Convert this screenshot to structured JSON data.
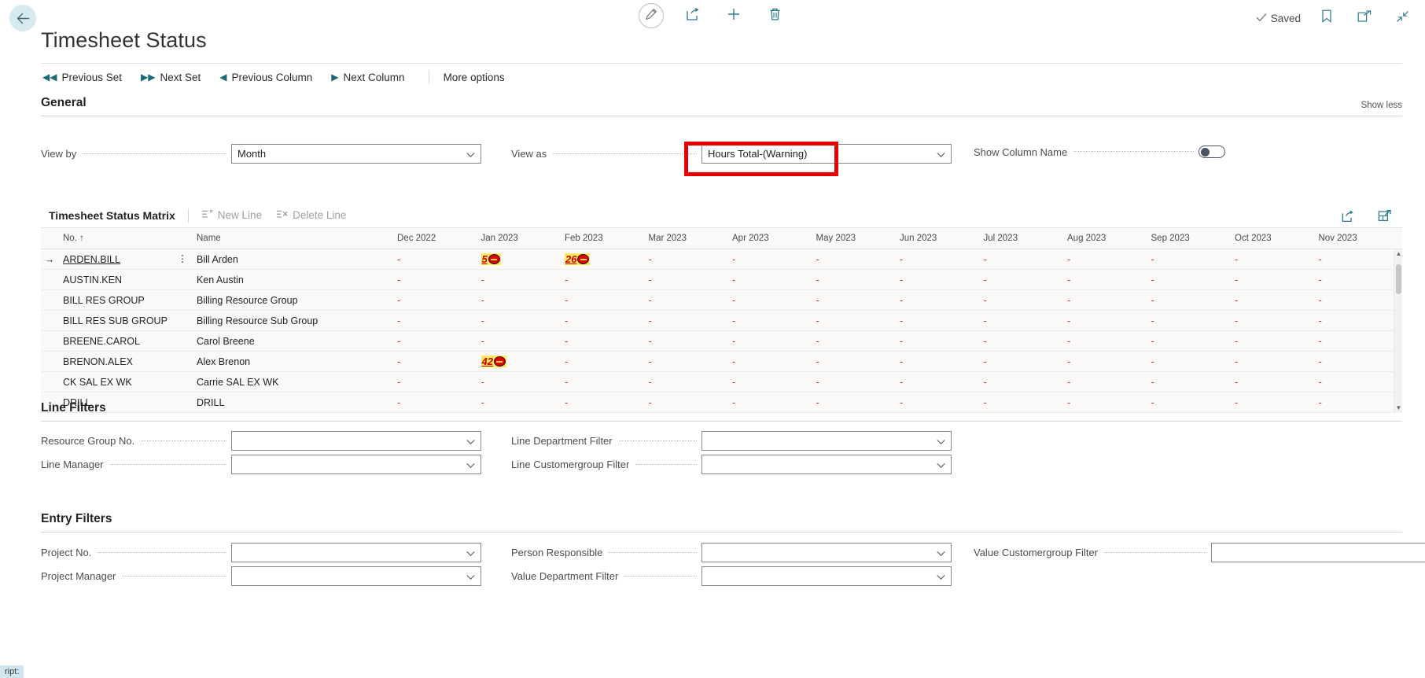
{
  "topbar": {
    "back_icon": "arrow-left-icon",
    "edit_icon": "pencil-icon",
    "share_icon": "share-icon",
    "new_icon": "plus-icon",
    "delete_icon": "trash-icon",
    "saved_label": "Saved",
    "check_icon": "check-icon",
    "bookmark_icon": "bookmark-icon",
    "open-new-window_icon": "open-in-new-window-icon",
    "collapse_icon": "collapse-icon"
  },
  "page_title": "Timesheet Status",
  "ribbon": {
    "items": [
      {
        "label": "Previous Set",
        "glyph": "◀◀",
        "icon": "previous-set-icon"
      },
      {
        "label": "Next Set",
        "glyph": "▶▶",
        "icon": "next-set-icon"
      },
      {
        "label": "Previous Column",
        "glyph": "◀",
        "icon": "previous-column-icon"
      },
      {
        "label": "Next Column",
        "glyph": "▶",
        "icon": "next-column-icon"
      }
    ],
    "more_options": "More options"
  },
  "general": {
    "title": "General",
    "show_less": "Show less",
    "view_by": {
      "label": "View by",
      "value": "Month"
    },
    "view_as": {
      "label": "View as",
      "value": "Hours Total-(Warning)"
    },
    "show_column_name": {
      "label": "Show Column Name",
      "value": "off"
    }
  },
  "highlight": {
    "color": "#e60000"
  },
  "matrix": {
    "title": "Timesheet Status Matrix",
    "new_line": "New Line",
    "delete_line": "Delete Line",
    "share_icon": "share-icon",
    "expand_icon": "open-in-excel-icon",
    "columns": [
      "No. ↑",
      "Name",
      "Dec 2022",
      "Jan 2023",
      "Feb 2023",
      "Mar 2023",
      "Apr 2023",
      "May 2023",
      "Jun 2023",
      "Jul 2023",
      "Aug 2023",
      "Sep 2023",
      "Oct 2023",
      "Nov 2023"
    ],
    "rows": [
      {
        "no": "ARDEN.BILL",
        "name": "Bill Arden",
        "selected": true,
        "values": [
          "-",
          {
            "text": "5",
            "warning": true
          },
          {
            "text": "26",
            "warning": true
          },
          "-",
          "-",
          "-",
          "-",
          "-",
          "-",
          "-",
          "-",
          "-"
        ]
      },
      {
        "no": "AUSTIN.KEN",
        "name": "Ken Austin",
        "selected": false,
        "values": [
          "-",
          "-",
          "-",
          "-",
          "-",
          "-",
          "-",
          "-",
          "-",
          "-",
          "-",
          "-"
        ]
      },
      {
        "no": "BILL RES GROUP",
        "name": "Billing Resource Group",
        "selected": false,
        "values": [
          "-",
          "-",
          "-",
          "-",
          "-",
          "-",
          "-",
          "-",
          "-",
          "-",
          "-",
          "-"
        ]
      },
      {
        "no": "BILL RES SUB GROUP",
        "name": "Billing Resource Sub Group",
        "selected": false,
        "values": [
          "-",
          "-",
          "-",
          "-",
          "-",
          "-",
          "-",
          "-",
          "-",
          "-",
          "-",
          "-"
        ]
      },
      {
        "no": "BREENE.CAROL",
        "name": "Carol Breene",
        "selected": false,
        "values": [
          "-",
          "-",
          "-",
          "-",
          "-",
          "-",
          "-",
          "-",
          "-",
          "-",
          "-",
          "-"
        ]
      },
      {
        "no": "BRENON.ALEX",
        "name": "Alex Brenon",
        "selected": false,
        "values": [
          "-",
          {
            "text": "42",
            "warning": true
          },
          "-",
          "-",
          "-",
          "-",
          "-",
          "-",
          "-",
          "-",
          "-",
          "-"
        ]
      },
      {
        "no": "CK SAL EX WK",
        "name": "Carrie SAL EX WK",
        "selected": false,
        "values": [
          "-",
          "-",
          "-",
          "-",
          "-",
          "-",
          "-",
          "-",
          "-",
          "-",
          "-",
          "-"
        ]
      },
      {
        "no": "DRILL",
        "name": "DRILL",
        "selected": false,
        "values": [
          "-",
          "-",
          "-",
          "-",
          "-",
          "-",
          "-",
          "-",
          "-",
          "-",
          "-",
          "-"
        ]
      }
    ]
  },
  "line_filters": {
    "title": "Line Filters",
    "fields": [
      {
        "label": "Resource Group No.",
        "value": "",
        "col": 0,
        "row": 0
      },
      {
        "label": "Line Manager",
        "value": "",
        "col": 0,
        "row": 1
      },
      {
        "label": "Line Department Filter",
        "value": "",
        "col": 1,
        "row": 0
      },
      {
        "label": "Line Customergroup Filter",
        "value": "",
        "col": 1,
        "row": 1
      }
    ]
  },
  "entry_filters": {
    "title": "Entry Filters",
    "fields": [
      {
        "label": "Project No.",
        "value": "",
        "col": 0,
        "row": 0
      },
      {
        "label": "Project Manager",
        "value": "",
        "col": 0,
        "row": 1
      },
      {
        "label": "Person Responsible",
        "value": "",
        "col": 1,
        "row": 0
      },
      {
        "label": "Value Department Filter",
        "value": "",
        "col": 1,
        "row": 1
      },
      {
        "label": "Value Customergroup Filter",
        "value": "",
        "col": 2,
        "row": 0
      }
    ]
  },
  "status_hint": "ript:"
}
